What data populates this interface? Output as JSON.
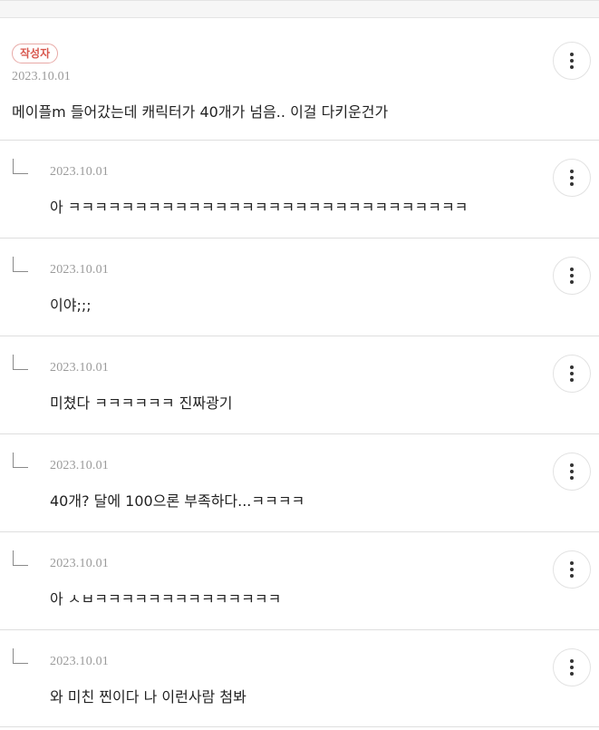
{
  "main_comment": {
    "badge": "작성자",
    "date": "2023.10.01",
    "text": "메이플m 들어갔는데 캐릭터가 40개가 넘음.. 이걸 다키운건가"
  },
  "replies": [
    {
      "date": "2023.10.01",
      "text": "아 ㅋㅋㅋㅋㅋㅋㅋㅋㅋㅋㅋㅋㅋㅋㅋㅋㅋㅋㅋㅋㅋㅋㅋㅋㅋㅋㅋㅋㅋㅋ"
    },
    {
      "date": "2023.10.01",
      "text": "이야;;;"
    },
    {
      "date": "2023.10.01",
      "text": "미쳤다 ㅋㅋㅋㅋㅋㅋ 진짜광기"
    },
    {
      "date": "2023.10.01",
      "text": "40개? 달에 100으론 부족하다...ㅋㅋㅋㅋ"
    },
    {
      "date": "2023.10.01",
      "text": "아 ㅅㅂㅋㅋㅋㅋㅋㅋㅋㅋㅋㅋㅋㅋㅋㅋ"
    },
    {
      "date": "2023.10.01",
      "text": "와 미친 찐이다 나 이런사람 첨봐"
    }
  ],
  "icons": {
    "more": "more-vertical-icon",
    "reply": "reply-arrow-icon"
  }
}
